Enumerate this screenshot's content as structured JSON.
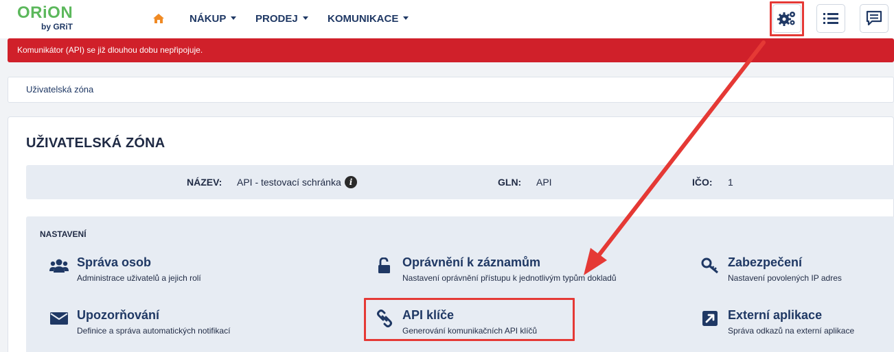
{
  "app": {
    "logo_main": "ORiON",
    "logo_sub": "by GRiT"
  },
  "nav": {
    "items": [
      {
        "label": "NÁKUP"
      },
      {
        "label": "PRODEJ"
      },
      {
        "label": "KOMUNIKACE"
      }
    ],
    "home_icon": "home-icon",
    "right_icons": [
      "settings-gears-icon",
      "list-icon",
      "chat-icon"
    ]
  },
  "alert": {
    "text": "Komunikátor (API) se již dlouhou dobu nepřipojuje."
  },
  "breadcrumb": {
    "text": "Uživatelská zóna"
  },
  "main": {
    "title": "UŽIVATELSKÁ ZÓNA",
    "info": {
      "name_label": "NÁZEV:",
      "name_value": "API - testovací schránka",
      "info_glyph": "i",
      "gln_label": "GLN:",
      "gln_value": "API",
      "ico_label": "IČO:",
      "ico_value": "1"
    },
    "settings": {
      "title": "NASTAVENÍ",
      "tiles": [
        {
          "title": "Správa osob",
          "desc": "Administrace uživatelů a jejich rolí",
          "icon": "users-icon"
        },
        {
          "title": "Oprávnění k záznamům",
          "desc": "Nastavení oprávnění přístupu k jednotlivým typům dokladů",
          "icon": "unlock-icon"
        },
        {
          "title": "Zabezpečení",
          "desc": "Nastavení povolených IP adres",
          "icon": "key-icon"
        },
        {
          "title": "Upozorňování",
          "desc": "Definice a správa automatických notifikací",
          "icon": "envelope-icon"
        },
        {
          "title": "API klíče",
          "desc": "Generování komunikačních API klíčů",
          "icon": "link-icon"
        },
        {
          "title": "Externí aplikace",
          "desc": "Správa odkazů na externí aplikace",
          "icon": "external-link-icon"
        }
      ]
    }
  },
  "colors": {
    "brand_green": "#5cb85c",
    "navy": "#1f3864",
    "alert_red": "#d0202a",
    "annotation_red": "#e53935",
    "home_orange": "#f08a24"
  }
}
